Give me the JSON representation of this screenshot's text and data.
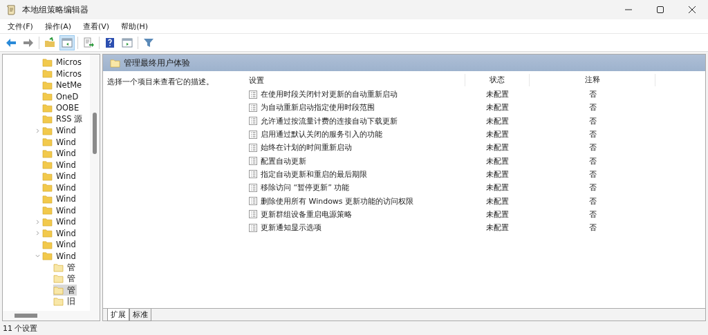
{
  "window": {
    "title": "本地组策略编辑器"
  },
  "menu": [
    "文件(F)",
    "操作(A)",
    "查看(V)",
    "帮助(H)"
  ],
  "tree": [
    {
      "label": "Micros"
    },
    {
      "label": "Micros"
    },
    {
      "label": "NetMe"
    },
    {
      "label": "OneD"
    },
    {
      "label": "OOBE"
    },
    {
      "label": "RSS 源"
    },
    {
      "label": "Wind",
      "expanded": false
    },
    {
      "label": "Wind"
    },
    {
      "label": "Wind"
    },
    {
      "label": "Wind"
    },
    {
      "label": "Wind"
    },
    {
      "label": "Wind"
    },
    {
      "label": "Wind"
    },
    {
      "label": "Wind"
    },
    {
      "label": "Wind",
      "expanded": false
    },
    {
      "label": "Wind",
      "expanded": false
    },
    {
      "label": "Wind"
    },
    {
      "label": "Wind",
      "expanded": true,
      "children": [
        {
          "label": "管",
          "selected": false
        },
        {
          "label": "管",
          "selected": false
        },
        {
          "label": "管",
          "selected": true
        },
        {
          "label": "旧",
          "selected": false
        }
      ]
    }
  ],
  "panel_title": "管理最终用户体验",
  "description": "选择一个项目来查看它的描述。",
  "table": {
    "columns": [
      "设置",
      "状态",
      "注释"
    ],
    "rows": [
      [
        "在使用时段关闭针对更新的自动重新启动",
        "未配置",
        "否"
      ],
      [
        "为自动重新启动指定使用时段范围",
        "未配置",
        "否"
      ],
      [
        "允许通过按流量计费的连接自动下载更新",
        "未配置",
        "否"
      ],
      [
        "启用通过默认关闭的服务引入的功能",
        "未配置",
        "否"
      ],
      [
        "始终在计划的时间重新启动",
        "未配置",
        "否"
      ],
      [
        "配置自动更新",
        "未配置",
        "否"
      ],
      [
        "指定自动更新和重启的最后期限",
        "未配置",
        "否"
      ],
      [
        "移除访问 “暂停更新” 功能",
        "未配置",
        "否"
      ],
      [
        "删除使用所有 Windows 更新功能的访问权限",
        "未配置",
        "否"
      ],
      [
        "更新群组设备重启电源策略",
        "未配置",
        "否"
      ],
      [
        "更新通知显示选项",
        "未配置",
        "否"
      ]
    ]
  },
  "view_tabs": [
    {
      "label": "扩展",
      "selected": true
    },
    {
      "label": "标准",
      "selected": false
    }
  ],
  "status_bar": "11 个设置"
}
